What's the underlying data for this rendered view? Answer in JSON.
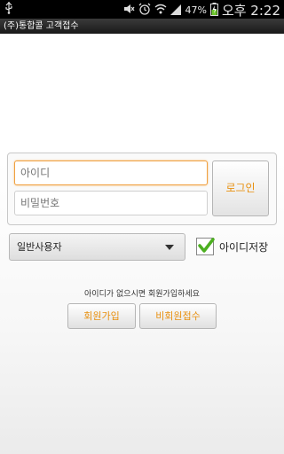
{
  "status_bar": {
    "battery_percent": "47%",
    "clock": "오후 2:22"
  },
  "app": {
    "title": "(주)통합콜 고객접수"
  },
  "login": {
    "id_placeholder": "아이디",
    "password_placeholder": "비밀번호",
    "login_label": "로그인",
    "user_type_selected": "일반사용자",
    "save_id_label": "아이디저장",
    "save_id_checked": true
  },
  "signup": {
    "hint": "아이디가 없으시면 회원가입하세요",
    "join_label": "회원가입",
    "guest_label": "비회원접수"
  },
  "colors": {
    "accent": "#e8900f",
    "focus_border": "#f0a040",
    "check_green": "#4caf20"
  }
}
